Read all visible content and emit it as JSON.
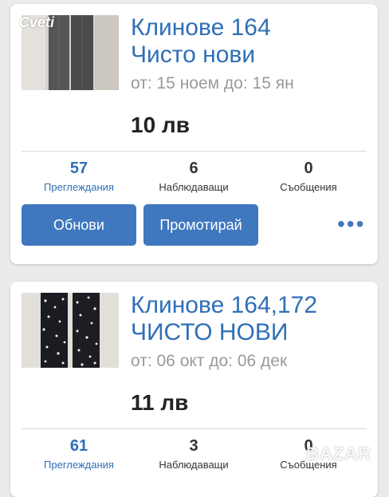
{
  "listings": [
    {
      "title_line1": "Клинове 164",
      "title_line2": "Чисто нови",
      "dates": "от: 15 ноем до: 15 ян",
      "price": "10 лв",
      "stats": {
        "views": "57",
        "views_label": "Преглеждания",
        "watchers": "6",
        "watchers_label": "Наблюдаващи",
        "messages": "0",
        "messages_label": "Съобщения"
      },
      "actions": {
        "refresh": "Обнови",
        "promote": "Промотирай",
        "more": "•••"
      }
    },
    {
      "title_line1": "Клинове 164,172",
      "title_line2": "ЧИСТО НОВИ",
      "dates": "от: 06 окт до: 06 дек",
      "price": "11 лв",
      "stats": {
        "views": "61",
        "views_label": "Преглеждания",
        "watchers": "3",
        "watchers_label": "Наблюдаващи",
        "messages": "0",
        "messages_label": "Съобщения"
      }
    }
  ],
  "watermarks": {
    "top_left": "Cveti",
    "bottom_right": "BAZAR"
  },
  "colors": {
    "accent": "#3f78bf",
    "title": "#2f6fb6",
    "background": "#ebebeb"
  }
}
